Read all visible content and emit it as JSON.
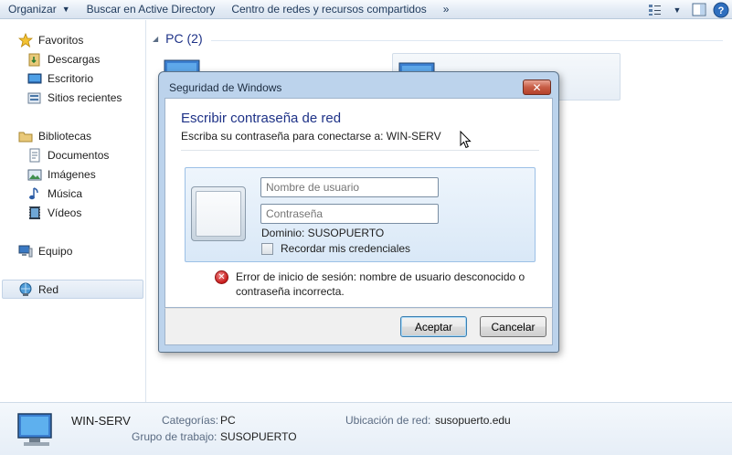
{
  "toolbar": {
    "organize": "Organizar",
    "search_ad": "Buscar en Active Directory",
    "network_center": "Centro de redes y recursos compartidos",
    "more": "»"
  },
  "nav": {
    "favorites": "Favoritos",
    "downloads": "Descargas",
    "desktop": "Escritorio",
    "recent": "Sitios recientes",
    "libraries": "Bibliotecas",
    "documents": "Documentos",
    "images": "Imágenes",
    "music": "Música",
    "videos": "Vídeos",
    "computer": "Equipo",
    "network": "Red"
  },
  "content": {
    "group_title": "PC (2)"
  },
  "dialog": {
    "window_title": "Seguridad de Windows",
    "close": "✕",
    "heading": "Escribir contraseña de red",
    "subtitle": "Escriba su contraseña para conectarse a: WIN-SERV",
    "username_placeholder": "Nombre de usuario",
    "password_placeholder": "Contraseña",
    "domain": "Dominio: SUSOPUERTO",
    "remember": "Recordar mis credenciales",
    "error_icon": "✕",
    "error": "Error de inicio de sesión: nombre de usuario desconocido o contraseña incorrecta.",
    "ok": "Aceptar",
    "cancel": "Cancelar"
  },
  "details": {
    "name": "WIN-SERV",
    "categories_label": "Categorías:",
    "categories_value": "PC",
    "workgroup_label": "Grupo de trabajo:",
    "workgroup_value": "SUSOPUERTO",
    "location_label": "Ubicación de red:",
    "location_value": "susopuerto.edu"
  },
  "colors": {
    "accent_blue": "#1e3287",
    "dialog_frame": "#bcd3ec",
    "close_red": "#c75d45",
    "error_red": "#c81a1a"
  },
  "icons": [
    "chevron-down-icon",
    "view-options-icon",
    "preview-pane-icon",
    "help-icon",
    "star-icon",
    "folder-icon",
    "desktop-icon",
    "recent-places-icon",
    "library-icon",
    "document-icon",
    "image-icon",
    "music-icon",
    "video-icon",
    "computer-icon",
    "network-icon",
    "pc-icon",
    "error-icon",
    "cursor-icon"
  ]
}
